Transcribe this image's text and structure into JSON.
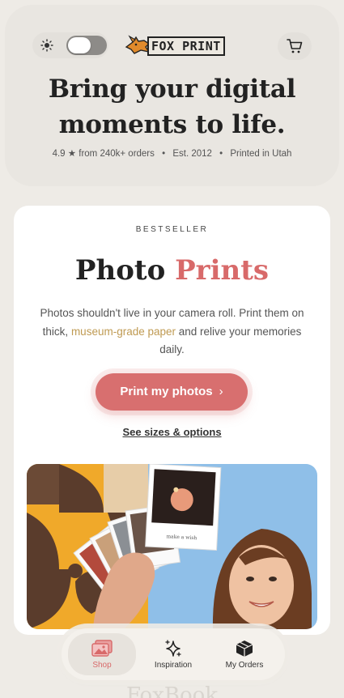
{
  "header": {
    "brand_text": "FOX PRINT",
    "hero_title_line1": "Bring your digital",
    "hero_title_line2": "moments to life.",
    "rating": "4.9 ★ from 240k+ orders",
    "established": "Est. 2012",
    "printed_in": "Printed in Utah",
    "separator": "•"
  },
  "product": {
    "eyebrow": "BESTSELLER",
    "title_part1": "Photo",
    "title_part2": "Prints",
    "desc_before": "Photos shouldn't live in your camera roll. Print them on thick,",
    "desc_link": "museum-grade paper",
    "desc_after": "and relive your memories daily.",
    "cta_label": "Print my photos",
    "cta_chevron": "›",
    "secondary_link": "See sizes & options",
    "polaroid_caption": "make a wish"
  },
  "nav": {
    "items": [
      {
        "label": "Shop",
        "icon": "photos-icon",
        "active": true
      },
      {
        "label": "Inspiration",
        "icon": "sparkle-icon",
        "active": false
      },
      {
        "label": "My Orders",
        "icon": "box-icon",
        "active": false
      }
    ]
  },
  "footer": {
    "peek_text": "FoxBook"
  },
  "colors": {
    "accent": "#d86f6f",
    "link": "#bf9a52",
    "background": "#eeebe6"
  }
}
